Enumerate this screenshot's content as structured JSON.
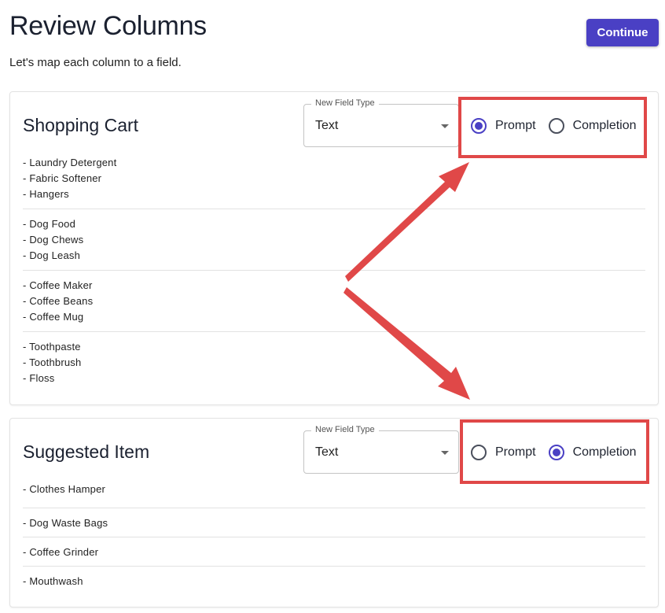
{
  "header": {
    "title": "Review Columns",
    "subtitle": "Let's map each column to a field.",
    "continue_label": "Continue"
  },
  "columns": [
    {
      "title": "Shopping Cart",
      "field_type_label": "New Field Type",
      "field_type_value": "Text",
      "radio": {
        "prompt_label": "Prompt",
        "completion_label": "Completion",
        "selected": "Prompt"
      },
      "rows": [
        [
          "- Laundry Detergent",
          "- Fabric Softener",
          "- Hangers"
        ],
        [
          "- Dog Food",
          "- Dog Chews",
          "- Dog Leash"
        ],
        [
          "- Coffee Maker",
          "- Coffee Beans",
          "- Coffee Mug"
        ],
        [
          "- Toothpaste",
          "- Toothbrush",
          "- Floss"
        ]
      ]
    },
    {
      "title": "Suggested Item",
      "field_type_label": "New Field Type",
      "field_type_value": "Text",
      "radio": {
        "prompt_label": "Prompt",
        "completion_label": "Completion",
        "selected": "Completion"
      },
      "rows": [
        [
          "- Clothes Hamper"
        ],
        [
          "- Dog Waste Bags"
        ],
        [
          "- Coffee Grinder"
        ],
        [
          "- Mouthwash"
        ]
      ]
    }
  ],
  "colors": {
    "accent": "#4a40c4",
    "annotation": "#e04848"
  }
}
